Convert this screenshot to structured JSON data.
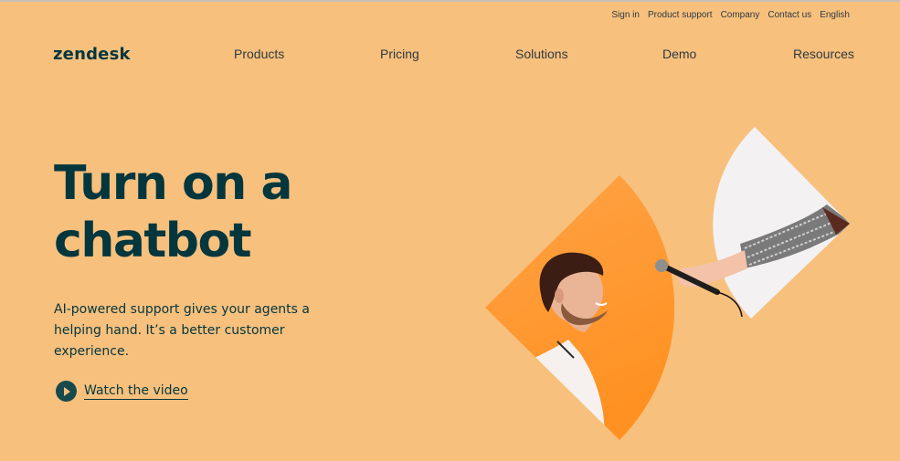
{
  "brand": {
    "logo_text": "zendesk"
  },
  "utility_nav": [
    {
      "label": "Sign in"
    },
    {
      "label": "Product support"
    },
    {
      "label": "Company"
    },
    {
      "label": "Contact us"
    },
    {
      "label": "English"
    }
  ],
  "main_nav": [
    {
      "label": "Products"
    },
    {
      "label": "Pricing"
    },
    {
      "label": "Solutions"
    },
    {
      "label": "Demo"
    },
    {
      "label": "Resources"
    }
  ],
  "hero": {
    "title_line1": "Turn on a",
    "title_line2": "chatbot",
    "subtitle": "AI-powered support gives your agents a helping hand. It’s a better customer experience.",
    "cta_label": "Watch the video",
    "cta_icon": "play-circle-icon"
  },
  "illustration": {
    "left_panel": "man-smiling-photo",
    "right_panel": "hand-holding-microphone-photo"
  },
  "colors": {
    "background": "#f7c07d",
    "primary_text": "#03363d",
    "accent_orange": "#ff9e3d",
    "panel_white": "#f3f1f2"
  }
}
